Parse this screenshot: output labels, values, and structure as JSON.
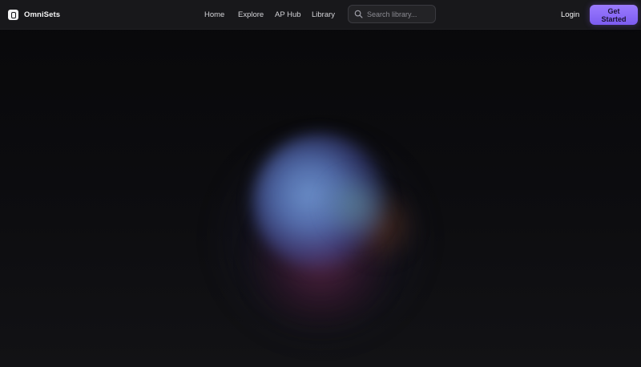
{
  "brand": {
    "name": "OmniSets",
    "logo_icon": "omnisets-logo-icon"
  },
  "nav": {
    "items": [
      {
        "label": "Home"
      },
      {
        "label": "Explore"
      },
      {
        "label": "AP Hub"
      },
      {
        "label": "Library"
      }
    ]
  },
  "search": {
    "placeholder": "Search library...",
    "value": "",
    "icon": "search-icon"
  },
  "actions": {
    "login_label": "Login",
    "cta_label": "Get Started"
  },
  "colors": {
    "background": "#0c0c0e",
    "navbar": "#18181b",
    "accent": "#8b6cf7",
    "orb_blue": "#7096d2",
    "orb_magenta": "#782850"
  }
}
